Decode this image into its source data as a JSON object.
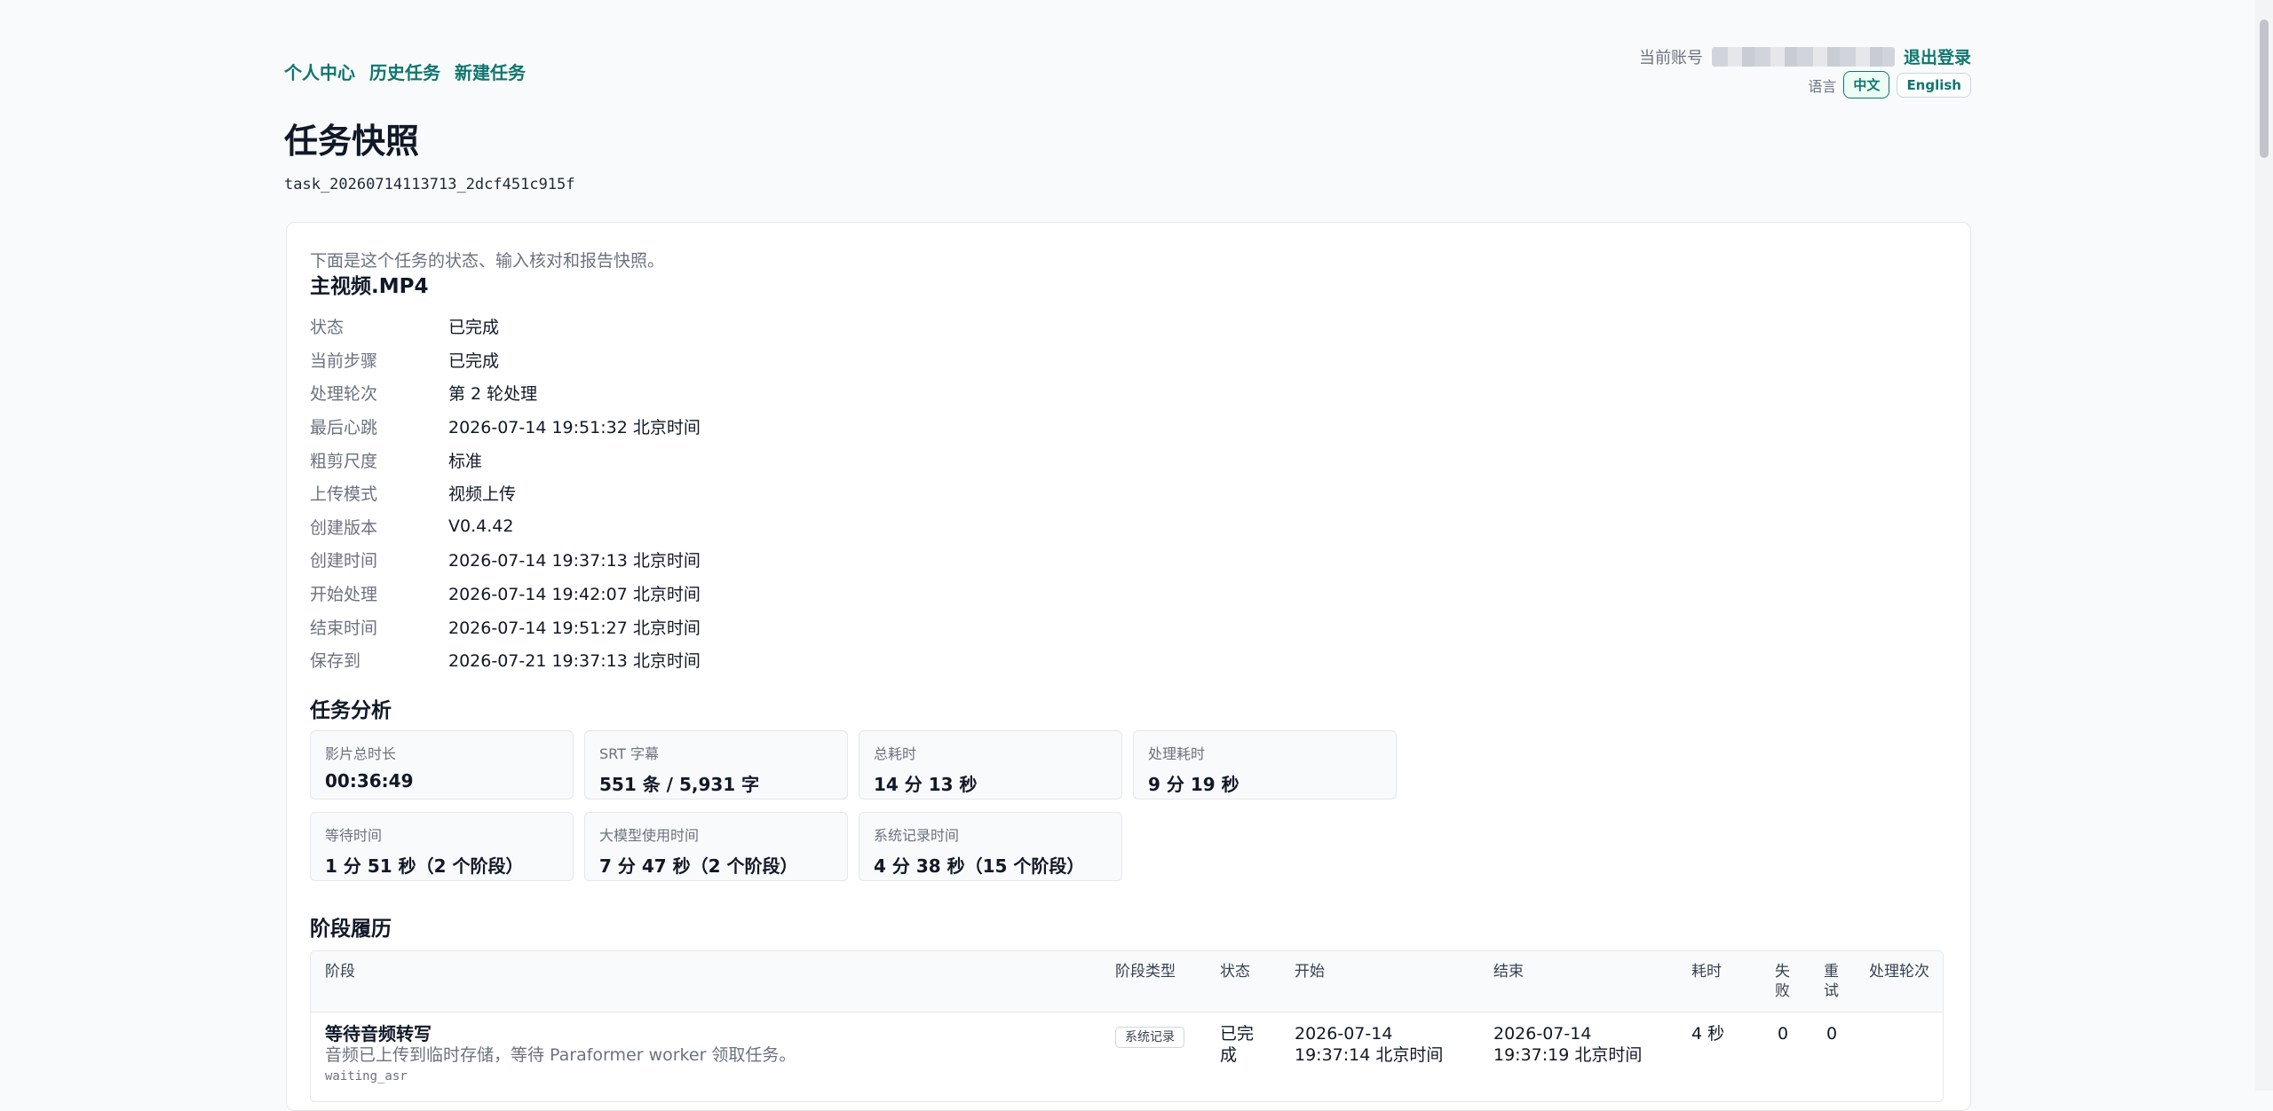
{
  "nav": {
    "items": [
      "个人中心",
      "历史任务",
      "新建任务"
    ]
  },
  "account": {
    "label": "当前账号",
    "logout": "退出登录"
  },
  "language": {
    "label": "语言",
    "options": [
      "中文",
      "English"
    ],
    "selected": "中文"
  },
  "page": {
    "title": "任务快照",
    "task_id": "task_20260714113713_2dcf451c915f"
  },
  "card": {
    "intro": "下面是这个任务的状态、输入核对和报告快照。",
    "file_name": "主视频.MP4",
    "fields": [
      {
        "key": "状态",
        "value": "已完成"
      },
      {
        "key": "当前步骤",
        "value": "已完成"
      },
      {
        "key": "处理轮次",
        "value": "第 2 轮处理"
      },
      {
        "key": "最后心跳",
        "value": "2026-07-14 19:51:32 北京时间"
      },
      {
        "key": "粗剪尺度",
        "value": "标准"
      },
      {
        "key": "上传模式",
        "value": "视频上传"
      },
      {
        "key": "创建版本",
        "value": "V0.4.42"
      },
      {
        "key": "创建时间",
        "value": "2026-07-14 19:37:13 北京时间"
      },
      {
        "key": "开始处理",
        "value": "2026-07-14 19:42:07 北京时间"
      },
      {
        "key": "结束时间",
        "value": "2026-07-14 19:51:27 北京时间"
      },
      {
        "key": "保存到",
        "value": "2026-07-21 19:37:13 北京时间"
      }
    ]
  },
  "analysis": {
    "title": "任务分析",
    "stats": [
      {
        "label": "影片总时长",
        "value": "00:36:49"
      },
      {
        "label": "SRT 字幕",
        "value": "551 条 / 5,931 字"
      },
      {
        "label": "总耗时",
        "value": "14 分 13 秒"
      },
      {
        "label": "处理耗时",
        "value": "9 分 19 秒"
      },
      {
        "label": "等待时间",
        "value": "1 分 51 秒（2 个阶段）"
      },
      {
        "label": "大模型使用时间",
        "value": "7 分 47 秒（2 个阶段）"
      },
      {
        "label": "系统记录时间",
        "value": "4 分 38 秒（15 个阶段）"
      }
    ]
  },
  "history": {
    "title": "阶段履历",
    "headers": {
      "stage": "阶段",
      "type": "阶段类型",
      "status": "状态",
      "start": "开始",
      "end": "结束",
      "duration": "耗时",
      "fail_1": "失",
      "fail_2": "败",
      "retry_1": "重",
      "retry_2": "试",
      "round": "处理轮次"
    },
    "rows": [
      {
        "name": "等待音频转写",
        "desc": "音频已上传到临时存储，等待 Paraformer worker 领取任务。",
        "code": "waiting_asr",
        "type": "系统记录",
        "status_1": "已完",
        "status_2": "成",
        "start_date": "2026-07-14",
        "start_time": "19:37:14 北京时间",
        "end_date": "2026-07-14",
        "end_time": "19:37:19 北京时间",
        "duration": "4 秒",
        "fail": "0",
        "retry": "0"
      }
    ]
  }
}
